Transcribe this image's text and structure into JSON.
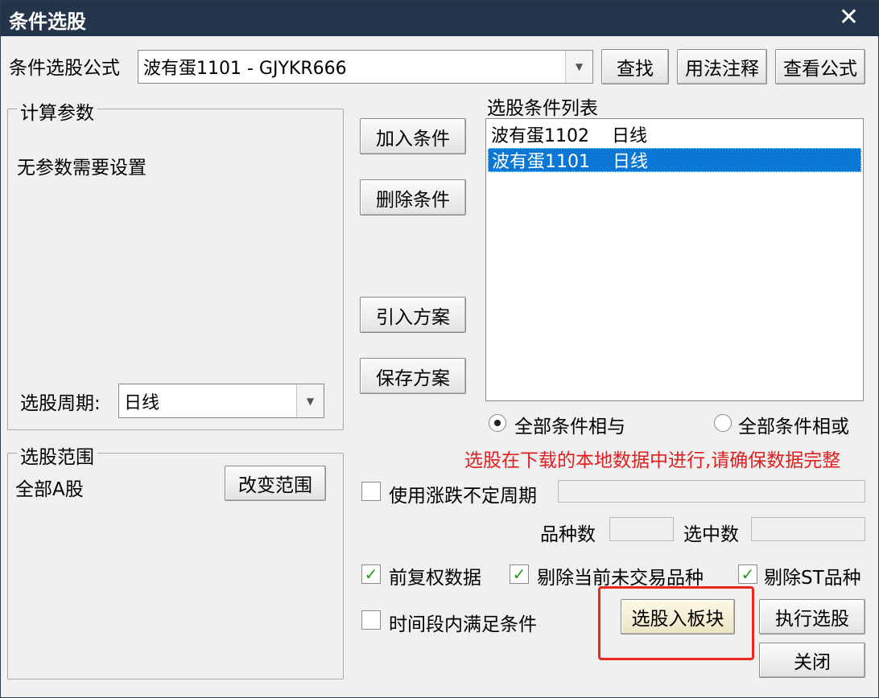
{
  "window": {
    "title": "条件选股",
    "close_glyph": "✕"
  },
  "formula": {
    "label": "条件选股公式",
    "value": "波有蛋1101   -   GJYKR666",
    "buttons": [
      "查找",
      "用法注释",
      "查看公式"
    ]
  },
  "params": {
    "group_title": "计算参数",
    "message": "无参数需要设置",
    "period_label": "选股周期:",
    "period_value": "日线"
  },
  "range": {
    "group_title": "选股范围",
    "value": "全部A股",
    "button": "改变范围"
  },
  "actions": {
    "add": "加入条件",
    "delete": "删除条件",
    "import": "引入方案",
    "save": "保存方案"
  },
  "conditions": {
    "title": "选股条件列表",
    "items": [
      {
        "name": "波有蛋1102",
        "period": "日线",
        "selected": false
      },
      {
        "name": "波有蛋1101",
        "period": "日线",
        "selected": true
      }
    ]
  },
  "logic": {
    "and_label": "全部条件相与",
    "or_label": "全部条件相或",
    "selected": "and"
  },
  "warning": {
    "text": "选股在下载的本地数据中进行,请确保数据完整",
    "color": "#e02020"
  },
  "options": {
    "variable_period": {
      "label": "使用涨跌不定周期",
      "checked": false
    },
    "count_label": "品种数",
    "selected_label": "选中数",
    "prerights": {
      "label": "前复权数据",
      "checked": true
    },
    "exclude_untraded": {
      "label": "剔除当前未交易品种",
      "checked": true
    },
    "exclude_st": {
      "label": "剔除ST品种",
      "checked": true
    },
    "time_window": {
      "label": "时间段内满足条件",
      "checked": false
    }
  },
  "bottom": {
    "to_block": "选股入板块",
    "execute": "执行选股",
    "close": "关闭"
  },
  "colors": {
    "highlight_box": "#e8281e",
    "selection": "#0a77d4",
    "titlebar": "#24344a"
  }
}
